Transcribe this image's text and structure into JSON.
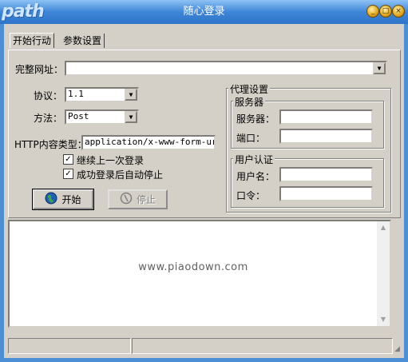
{
  "window": {
    "title": "随心登录",
    "logo_text": "path",
    "buttons": [
      "minimize",
      "maximize",
      "close"
    ]
  },
  "tabs": [
    {
      "label": "开始行动",
      "active": true
    },
    {
      "label": "参数设置",
      "active": false
    }
  ],
  "form": {
    "url_label": "完整网址：",
    "url_value": "",
    "protocol_label": "协议：",
    "protocol_value": "1.1",
    "method_label": "方法：",
    "method_value": "Post",
    "content_type_label": "HTTP内容类型：",
    "content_type_value": "application/x-www-form-urle:",
    "continue_last_label": "继续上一次登录",
    "continue_last_checked": true,
    "auto_stop_label": "成功登录后自动停止",
    "auto_stop_checked": true
  },
  "proxy": {
    "group_label": "代理设置",
    "server_group_label": "服务器",
    "server_label": "服务器：",
    "server_value": "",
    "port_label": "端口：",
    "port_value": "",
    "auth_group_label": "用户认证",
    "username_label": "用户名：",
    "username_value": "",
    "password_label": "口令：",
    "password_value": ""
  },
  "actions": {
    "start_label": "开始",
    "stop_label": "停止"
  },
  "output": {
    "watermark": "www.piaodown.com"
  },
  "colors": {
    "titlebar": "#3e86d8",
    "face": "#d4d0c8"
  },
  "icons": {
    "start": "globe-icon",
    "stop": "stop-icon"
  }
}
